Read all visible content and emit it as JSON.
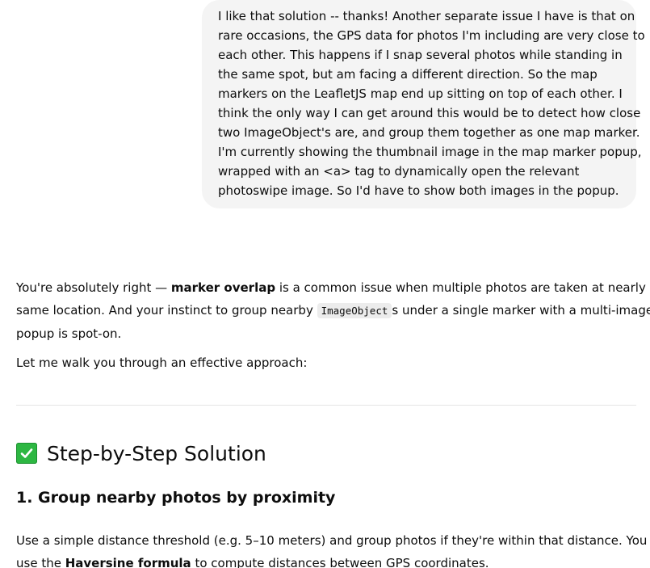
{
  "user_message": {
    "lines": [
      "I like that solution -- thanks!  Another separate issue I have is that on",
      "rare occasions, the GPS data for photos I'm including are very close to",
      "each other.  This happens if I snap several photos while standing in",
      "the same spot, but am facing a different direction.  So the map",
      "markers on the LeafletJS map end up sitting on top of each other.  I",
      "think the only way I can get around this would be to detect how close",
      "two ImageObject's are, and group them together as one map marker.",
      "I'm currently showing the thumbnail image in the map marker popup,",
      "wrapped with an <a> tag to dynamically open the relevant",
      "photoswipe image.  So I'd have to show both images in the popup."
    ]
  },
  "assistant": {
    "para1": {
      "l1_pre": "You're absolutely right — ",
      "l1_bold": "marker overlap",
      "l1_post": " is a common issue when multiple photos are taken at nearly the",
      "l2_pre": "same location. And your instinct to group nearby ",
      "l2_code": "ImageObject",
      "l2_post": "s under a single marker with a multi-image",
      "l3": "popup is spot-on."
    },
    "para2": "Let me walk you through an effective approach:",
    "heading": {
      "icon": "check-mark-button-icon",
      "text": "Step-by-Step Solution"
    },
    "subheading": "1. Group nearby photos by proximity",
    "para3": {
      "l1": "Use a simple distance threshold (e.g. 5–10 meters) and group photos if they're within that distance. You can",
      "l2_pre": "use the ",
      "l2_bold": "Haversine formula",
      "l2_post": " to compute distances between GPS coordinates."
    }
  },
  "colors": {
    "user_bubble_bg": "#f4f4f4",
    "check_green": "#2db742",
    "text": "#0d0d0d"
  }
}
